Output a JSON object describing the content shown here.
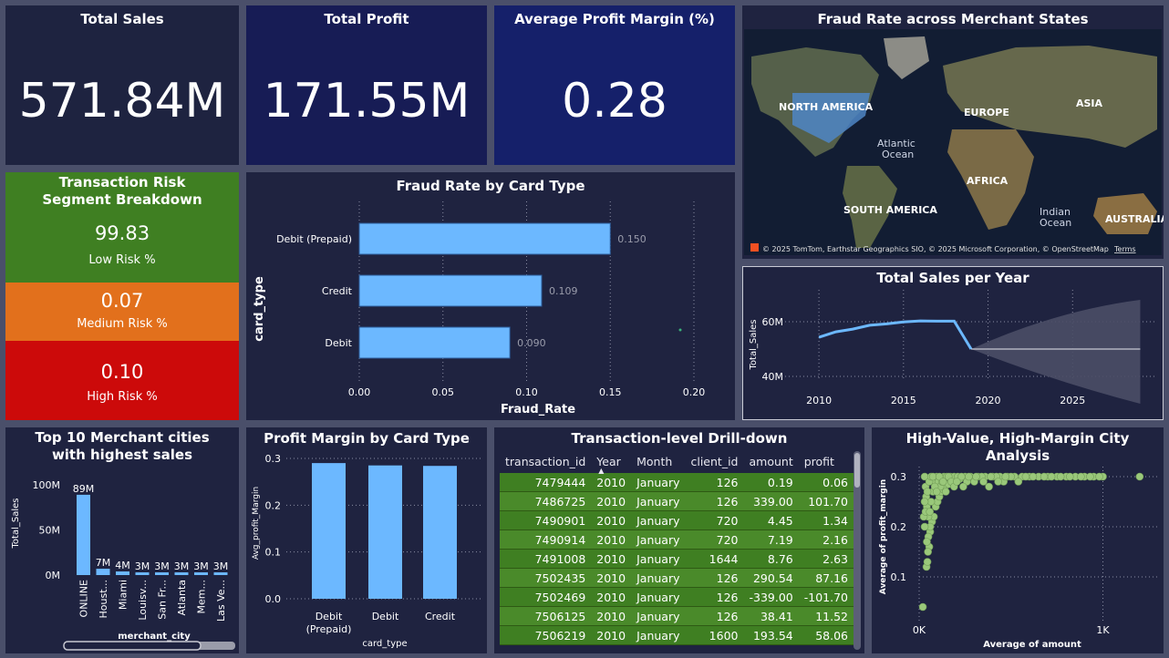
{
  "kpis": {
    "total_sales": {
      "title": "Total Sales",
      "value": "571.84M"
    },
    "total_profit": {
      "title": "Total Profit",
      "value": "171.55M"
    },
    "avg_margin": {
      "title": "Average Profit Margin (%)",
      "value": "0.28"
    }
  },
  "map": {
    "title": "Fraud Rate across Merchant States",
    "labels": {
      "north_america": "NORTH AMERICA",
      "europe": "EUROPE",
      "asia": "ASIA",
      "atlantic": "Atlantic",
      "ocean1": "Ocean",
      "africa": "AFRICA",
      "south_america": "SOUTH AMERICA",
      "indian": "Indian",
      "ocean2": "Ocean",
      "australia": "AUSTRALIA"
    },
    "attribution": "© 2025 TomTom, Earthstar Geographics SIO, © 2025 Microsoft Corporation, © OpenStreetMap",
    "terms": "Terms"
  },
  "risk": {
    "title": "Transaction Risk Segment Breakdown",
    "segments": [
      {
        "value": "99.83",
        "label": "Low Risk %",
        "color": "#3f7f22"
      },
      {
        "value": "0.07",
        "label": "Medium Risk %",
        "color": "#e2701c"
      },
      {
        "value": "0.10",
        "label": "High Risk %",
        "color": "#cc0a0a"
      }
    ]
  },
  "tables": {
    "drill": {
      "title": "Transaction-level Drill-down",
      "columns": [
        "transaction_id",
        "Year",
        "Month",
        "client_id",
        "amount",
        "profit"
      ],
      "rows": [
        [
          "7479444",
          "2010",
          "January",
          "126",
          "0.19",
          "0.06"
        ],
        [
          "7486725",
          "2010",
          "January",
          "126",
          "339.00",
          "101.70"
        ],
        [
          "7490901",
          "2010",
          "January",
          "720",
          "4.45",
          "1.34"
        ],
        [
          "7490914",
          "2010",
          "January",
          "720",
          "7.19",
          "2.16"
        ],
        [
          "7491008",
          "2010",
          "January",
          "1644",
          "8.76",
          "2.63"
        ],
        [
          "7502435",
          "2010",
          "January",
          "126",
          "290.54",
          "87.16"
        ],
        [
          "7502469",
          "2010",
          "January",
          "126",
          "-339.00",
          "-101.70"
        ],
        [
          "7506125",
          "2010",
          "January",
          "126",
          "38.41",
          "11.52"
        ],
        [
          "7506219",
          "2010",
          "January",
          "1600",
          "193.54",
          "58.06"
        ]
      ]
    }
  },
  "chart_data": [
    {
      "id": "fraud_card",
      "type": "bar",
      "orientation": "horizontal",
      "title": "Fraud Rate by Card Type",
      "xlabel": "Fraud_Rate",
      "ylabel": "card_type",
      "categories": [
        "Debit (Prepaid)",
        "Credit",
        "Debit"
      ],
      "values": [
        0.15,
        0.109,
        0.09
      ],
      "data_labels": [
        "0.150",
        "0.109",
        "0.090"
      ],
      "xlim": [
        0,
        0.2
      ],
      "xticks": [
        "0.00",
        "0.05",
        "0.10",
        "0.15",
        "0.20"
      ],
      "bar_color": "#6cb8ff"
    },
    {
      "id": "sales_year",
      "type": "line",
      "title": "Total Sales per Year",
      "xlabel": "",
      "ylabel": "Total_Sales",
      "x": [
        2010,
        2011,
        2012,
        2013,
        2014,
        2015,
        2016,
        2017,
        2018,
        2019
      ],
      "values": [
        54.3,
        56.3,
        57.3,
        58.7,
        59.2,
        59.9,
        60.3,
        60.2,
        60.2,
        50.0
      ],
      "forecast": {
        "x": [
          2019,
          2029
        ],
        "center": [
          50.0,
          50.0
        ],
        "upper": [
          50.0,
          68.0
        ],
        "lower": [
          50.0,
          30.0
        ]
      },
      "xticks": [
        "2010",
        "2015",
        "2020",
        "2025"
      ],
      "yticks": [
        "40M",
        "60M"
      ],
      "ylim": [
        30,
        70
      ],
      "xlim": [
        2008,
        2030
      ],
      "line_color": "#6cb8ff"
    },
    {
      "id": "top_cities",
      "type": "bar",
      "title": "Top 10 Merchant cities with highest sales",
      "xlabel": "merchant_city",
      "ylabel": "Total_Sales",
      "categories": [
        "ONLINE",
        "Houst...",
        "Miami",
        "Louisv...",
        "San Fr...",
        "Atlanta",
        "Mem...",
        "Las Ve..."
      ],
      "values": [
        89,
        7,
        4,
        3,
        3,
        3,
        3,
        3
      ],
      "data_labels": [
        "89M",
        "7M",
        "4M",
        "3M",
        "3M",
        "3M",
        "3M",
        "3M"
      ],
      "yticks": [
        "0M",
        "50M",
        "100M"
      ],
      "ylim": [
        0,
        100
      ],
      "bar_color": "#6cb8ff"
    },
    {
      "id": "margin_card",
      "type": "bar",
      "title": "Profit Margin by Card Type",
      "xlabel": "card_type",
      "ylabel": "Avg_profit_Margin",
      "categories": [
        "Debit\n(Prepaid)",
        "Debit",
        "Credit"
      ],
      "category_lines": [
        [
          "Debit",
          "(Prepaid)"
        ],
        [
          "Debit"
        ],
        [
          "Credit"
        ]
      ],
      "values": [
        0.29,
        0.285,
        0.284
      ],
      "yticks": [
        "0.0",
        "0.1",
        "0.2",
        "0.3"
      ],
      "ylim": [
        0,
        0.3
      ],
      "bar_color": "#6cb8ff"
    },
    {
      "id": "city_scatter",
      "type": "scatter",
      "title": "High-Value, High-Margin City Analysis",
      "xlabel": "Average of amount",
      "ylabel": "Average of profit_margin",
      "xticks": [
        "0K",
        "1K"
      ],
      "yticks": [
        "0.1",
        "0.2",
        "0.3"
      ],
      "xlim": [
        0,
        1300
      ],
      "ylim": [
        0.02,
        0.32
      ],
      "point_color": "#9ac87a",
      "points": [
        [
          20,
          0.04
        ],
        [
          55,
          0.16
        ],
        [
          60,
          0.19
        ],
        [
          70,
          0.21
        ],
        [
          80,
          0.22
        ],
        [
          40,
          0.12
        ],
        [
          45,
          0.13
        ],
        [
          90,
          0.24
        ],
        [
          100,
          0.25
        ],
        [
          110,
          0.26
        ],
        [
          120,
          0.27
        ],
        [
          130,
          0.275
        ],
        [
          140,
          0.28
        ],
        [
          160,
          0.285
        ],
        [
          180,
          0.29
        ],
        [
          200,
          0.295
        ],
        [
          220,
          0.295
        ],
        [
          250,
          0.3
        ],
        [
          280,
          0.3
        ],
        [
          320,
          0.3
        ],
        [
          360,
          0.3
        ],
        [
          400,
          0.3
        ],
        [
          440,
          0.3
        ],
        [
          480,
          0.3
        ],
        [
          520,
          0.3
        ],
        [
          560,
          0.3
        ],
        [
          600,
          0.3
        ],
        [
          650,
          0.3
        ],
        [
          700,
          0.3
        ],
        [
          750,
          0.3
        ],
        [
          800,
          0.3
        ],
        [
          850,
          0.3
        ],
        [
          900,
          0.3
        ],
        [
          950,
          0.3
        ],
        [
          1000,
          0.3
        ],
        [
          1200,
          0.3
        ],
        [
          30,
          0.3
        ],
        [
          35,
          0.28
        ],
        [
          38,
          0.26
        ],
        [
          42,
          0.24
        ],
        [
          50,
          0.22
        ],
        [
          60,
          0.2
        ],
        [
          65,
          0.25
        ],
        [
          75,
          0.27
        ],
        [
          85,
          0.29
        ],
        [
          95,
          0.3
        ],
        [
          105,
          0.29
        ],
        [
          115,
          0.28
        ],
        [
          125,
          0.29
        ],
        [
          135,
          0.3
        ],
        [
          150,
          0.3
        ],
        [
          170,
          0.3
        ],
        [
          190,
          0.3
        ],
        [
          210,
          0.3
        ],
        [
          230,
          0.3
        ],
        [
          260,
          0.29
        ],
        [
          300,
          0.29
        ],
        [
          340,
          0.3
        ],
        [
          380,
          0.28
        ],
        [
          420,
          0.3
        ],
        [
          460,
          0.29
        ],
        [
          500,
          0.3
        ],
        [
          540,
          0.29
        ],
        [
          580,
          0.3
        ],
        [
          620,
          0.3
        ],
        [
          30,
          0.25
        ],
        [
          25,
          0.22
        ],
        [
          30,
          0.2
        ],
        [
          35,
          0.23
        ],
        [
          45,
          0.27
        ],
        [
          55,
          0.29
        ],
        [
          65,
          0.3
        ],
        [
          75,
          0.3
        ],
        [
          85,
          0.28
        ],
        [
          95,
          0.27
        ],
        [
          110,
          0.3
        ],
        [
          130,
          0.29
        ],
        [
          145,
          0.27
        ],
        [
          160,
          0.3
        ],
        [
          175,
          0.29
        ],
        [
          190,
          0.28
        ],
        [
          205,
          0.29
        ],
        [
          240,
          0.28
        ],
        [
          270,
          0.3
        ],
        [
          310,
          0.3
        ],
        [
          350,
          0.29
        ],
        [
          390,
          0.3
        ],
        [
          430,
          0.29
        ],
        [
          470,
          0.3
        ],
        [
          680,
          0.3
        ],
        [
          720,
          0.3
        ],
        [
          770,
          0.3
        ],
        [
          820,
          0.3
        ],
        [
          880,
          0.3
        ],
        [
          930,
          0.3
        ],
        [
          980,
          0.3
        ],
        [
          50,
          0.18
        ],
        [
          48,
          0.15
        ],
        [
          42,
          0.17
        ],
        [
          58,
          0.23
        ]
      ]
    }
  ]
}
